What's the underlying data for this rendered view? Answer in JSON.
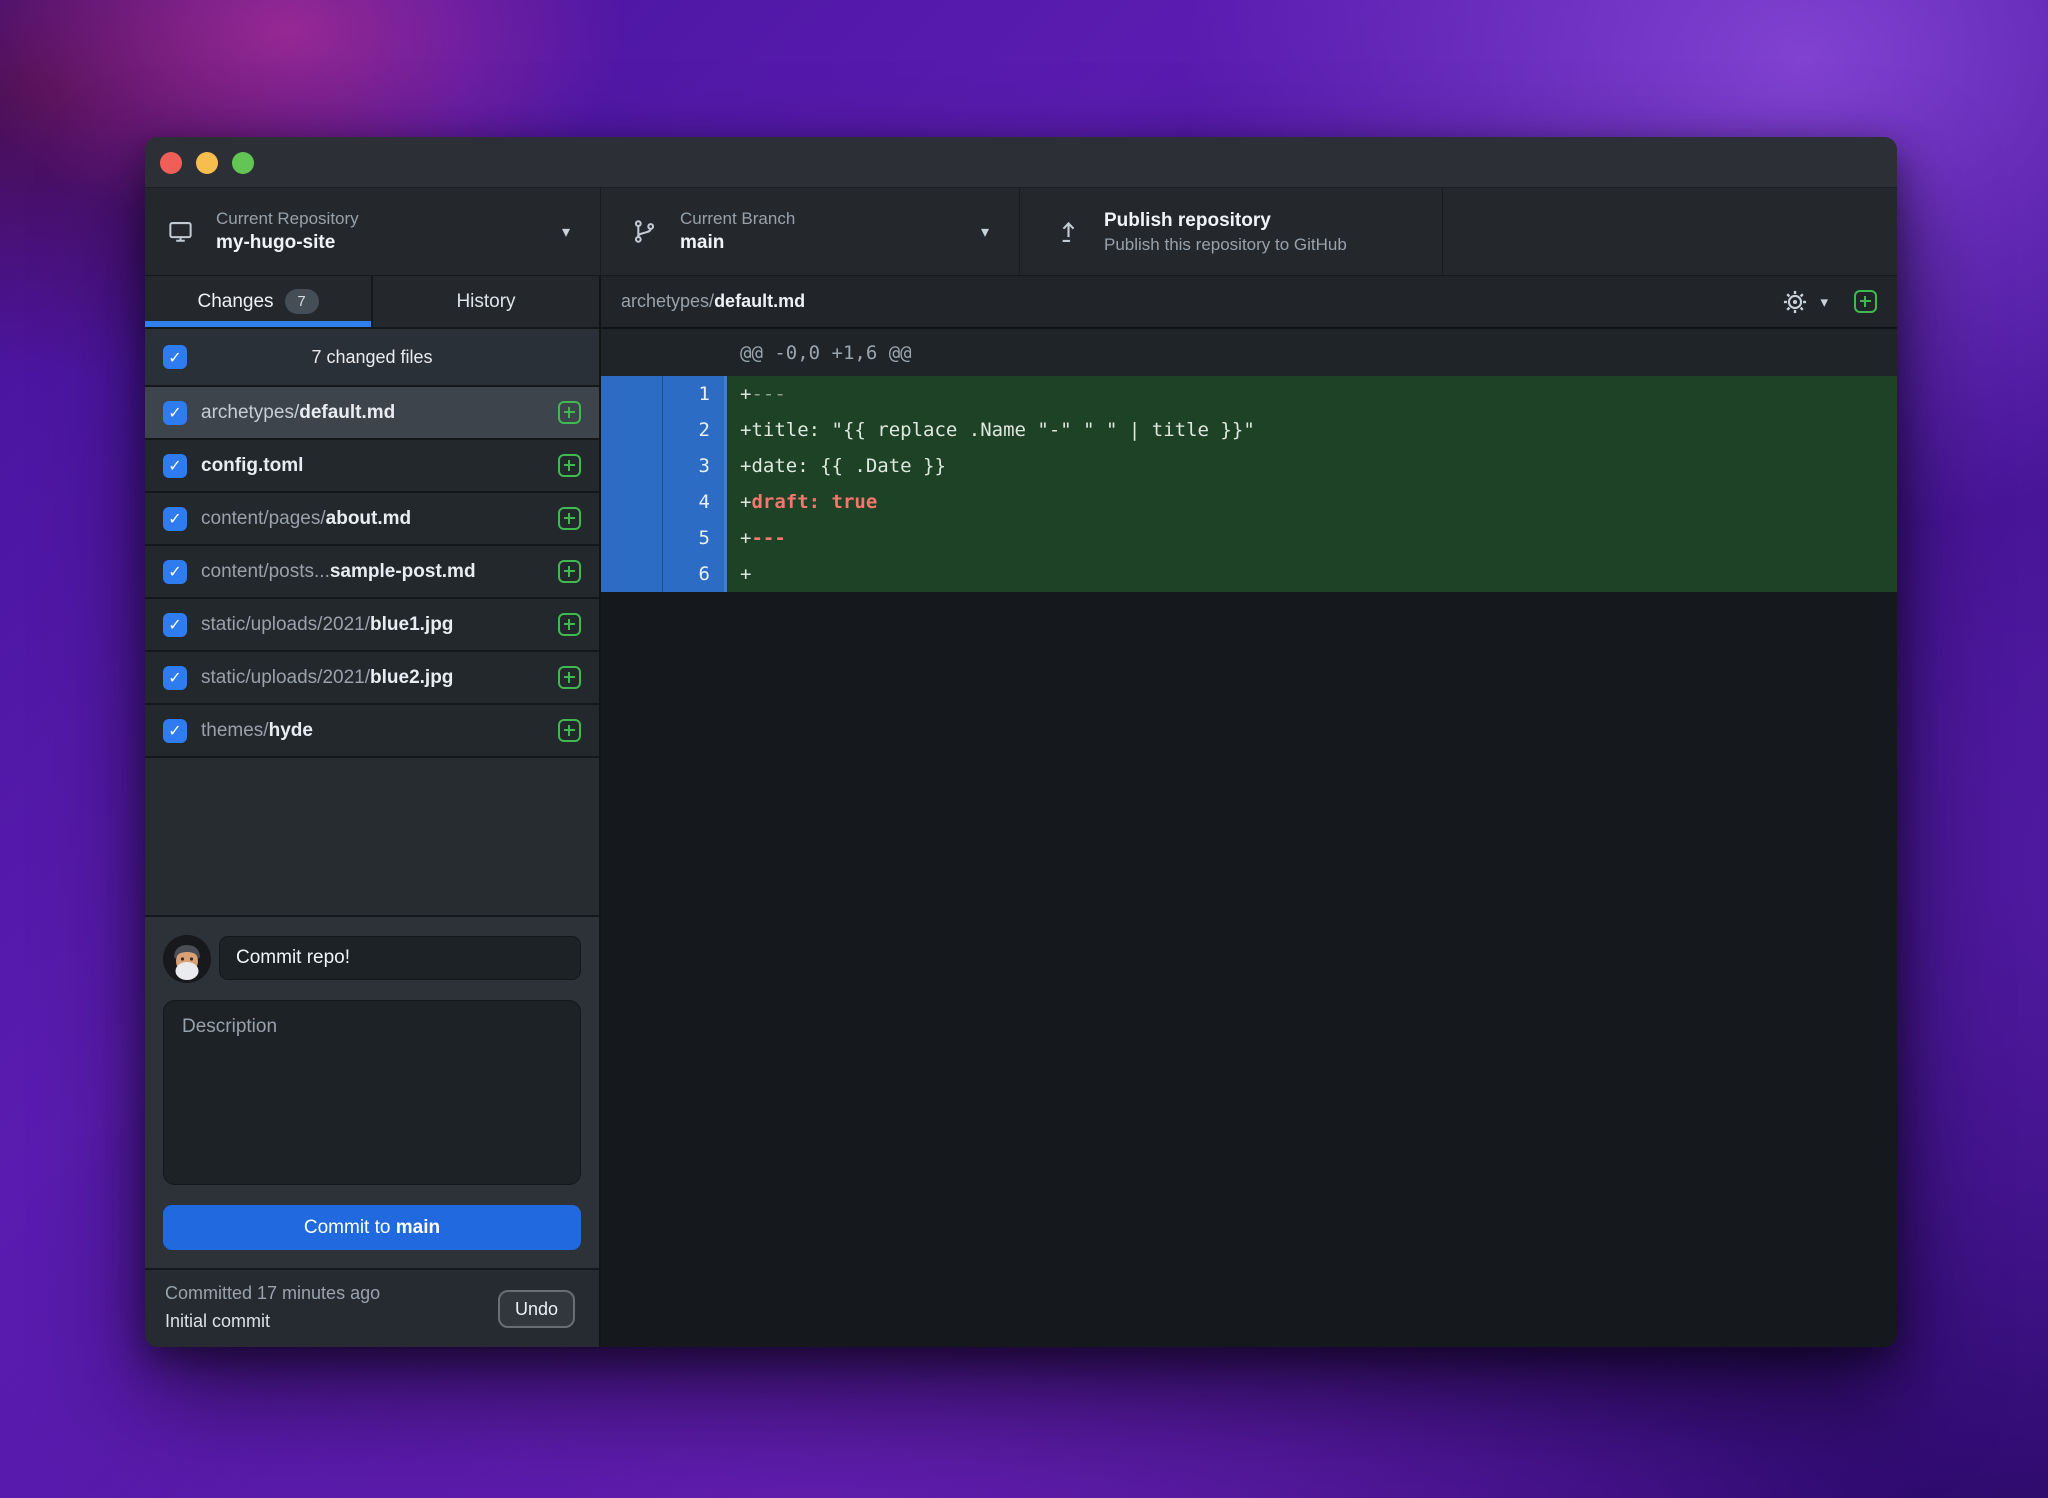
{
  "colors": {
    "accent_blue": "#2f80ed",
    "checkbox_blue": "#2e7cf0",
    "commit_button_blue": "#2069de",
    "add_green": "#3fb950",
    "diff_added_bg": "#1d4226",
    "diff_gutter_blue": "#2d6cc5",
    "diff_keyword_red": "#f4766c",
    "traffic_red": "#ef5f58",
    "traffic_yellow": "#f6bd4f",
    "traffic_green": "#62c554"
  },
  "window": {
    "toolbar": {
      "repository": {
        "label": "Current Repository",
        "value": "my-hugo-site"
      },
      "branch": {
        "label": "Current Branch",
        "value": "main"
      },
      "publish": {
        "title": "Publish repository",
        "subtitle": "Publish this repository to GitHub"
      }
    },
    "sidebar": {
      "tabs": [
        {
          "label": "Changes",
          "badge": "7"
        },
        {
          "label": "History"
        }
      ],
      "changed_files_summary": "7 changed files",
      "files": [
        {
          "path": "archetypes/",
          "name": "default.md",
          "selected": true
        },
        {
          "path": "",
          "name": "config.toml"
        },
        {
          "path": "content/pages/",
          "name": "about.md"
        },
        {
          "path": "content/posts...",
          "name": "sample-post.md"
        },
        {
          "path": "static/uploads/2021/",
          "name": "blue1.jpg"
        },
        {
          "path": "static/uploads/2021/",
          "name": "blue2.jpg"
        },
        {
          "path": "themes/",
          "name": "hyde"
        }
      ],
      "commit": {
        "summary_value": "Commit repo!",
        "description_placeholder": "Description",
        "button_prefix": "Commit to ",
        "button_branch": "main"
      },
      "history_bar": {
        "committed": "Committed 17 minutes ago",
        "message": "Initial commit",
        "undo_label": "Undo"
      }
    },
    "diff": {
      "file_path": "archetypes/",
      "file_name": "default.md",
      "hunk_header": "@@ -0,0 +1,6 @@",
      "lines": [
        {
          "num": "1",
          "segments": [
            {
              "t": "+",
              "c": "plain"
            },
            {
              "t": "---",
              "c": "muted"
            }
          ]
        },
        {
          "num": "2",
          "segments": [
            {
              "t": "+title: \"{{ replace .Name \"-\" \" \" | title }}\"",
              "c": "plain"
            }
          ]
        },
        {
          "num": "3",
          "segments": [
            {
              "t": "+date: {{ .Date }}",
              "c": "plain"
            }
          ]
        },
        {
          "num": "4",
          "segments": [
            {
              "t": "+",
              "c": "plain"
            },
            {
              "t": "draft: true",
              "c": "keyword"
            }
          ]
        },
        {
          "num": "5",
          "segments": [
            {
              "t": "+",
              "c": "plain"
            },
            {
              "t": "---",
              "c": "keyword"
            }
          ]
        },
        {
          "num": "6",
          "segments": [
            {
              "t": "+",
              "c": "plain"
            }
          ]
        }
      ]
    }
  }
}
